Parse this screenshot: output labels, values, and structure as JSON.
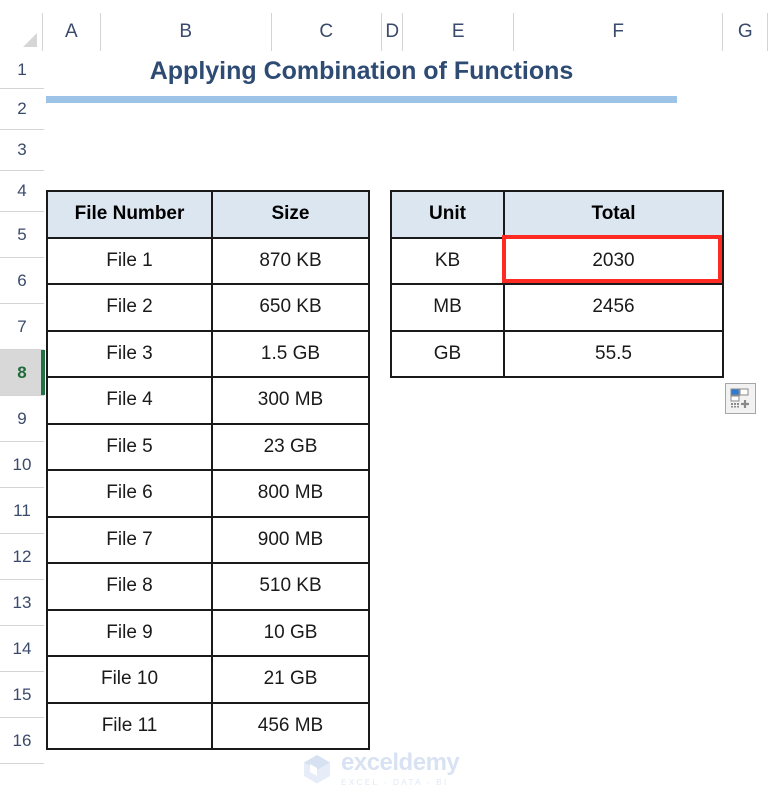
{
  "app": {
    "type": "spreadsheet",
    "selected_row_header": "8"
  },
  "column_headers": [
    "A",
    "B",
    "C",
    "D",
    "E",
    "F",
    "G"
  ],
  "row_headers": [
    "1",
    "2",
    "3",
    "4",
    "5",
    "6",
    "7",
    "8",
    "9",
    "10",
    "11",
    "12",
    "13",
    "14",
    "15",
    "16"
  ],
  "title": {
    "text": "Applying Combination of Functions",
    "color": "#2e4b73",
    "rule_color": "#9dc3e6"
  },
  "files_table": {
    "headers": [
      "File Number",
      "Size"
    ],
    "rows": [
      [
        "File 1",
        "870 KB"
      ],
      [
        "File 2",
        "650 KB"
      ],
      [
        "File 3",
        "1.5 GB"
      ],
      [
        "File 4",
        "300 MB"
      ],
      [
        "File 5",
        "23 GB"
      ],
      [
        "File 6",
        "800 MB"
      ],
      [
        "File 7",
        "900 MB"
      ],
      [
        "File 8",
        "510 KB"
      ],
      [
        "File 9",
        "10 GB"
      ],
      [
        "File 10",
        "21 GB"
      ],
      [
        "File 11",
        "456 MB"
      ]
    ]
  },
  "totals_table": {
    "headers": [
      "Unit",
      "Total"
    ],
    "rows": [
      [
        "KB",
        "2030"
      ],
      [
        "MB",
        "2456"
      ],
      [
        "GB",
        "55.5"
      ]
    ],
    "highlighted_cell": {
      "value": "2030",
      "border_color": "#ff2a21"
    }
  },
  "header_fill_color": "#dce6f1",
  "quick_analysis": {
    "icon": "quick-analysis-icon"
  },
  "watermark": {
    "name": "exceldemy",
    "tagline": "EXCEL - DATA - BI"
  }
}
